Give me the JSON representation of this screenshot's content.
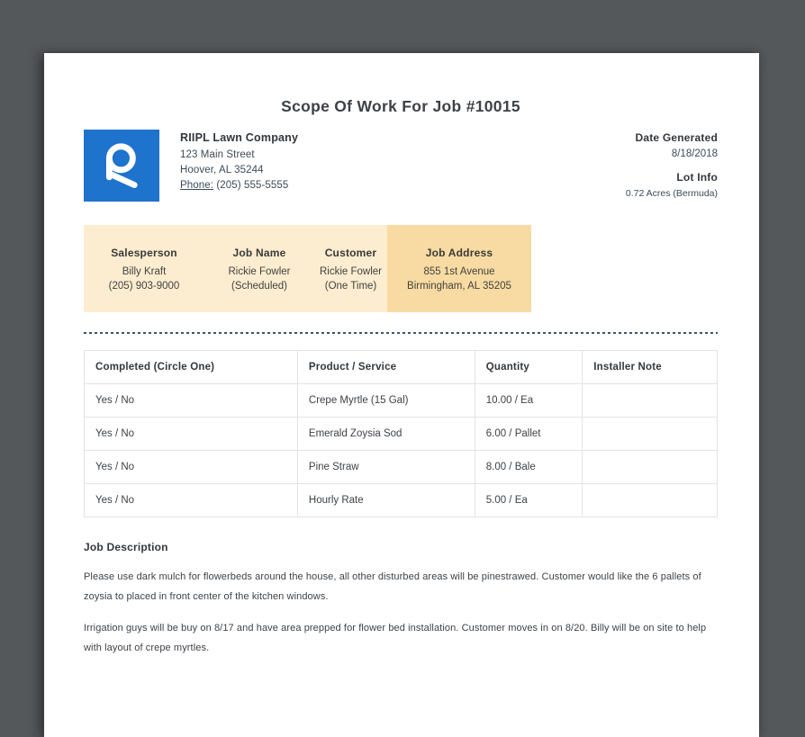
{
  "doc": {
    "title": "Scope Of Work For Job #10015"
  },
  "company": {
    "logo_icon": "r-lettermark",
    "logo_color": "#1e73cc",
    "name": "RIIPL Lawn Company",
    "address_line1": "123 Main Street",
    "address_line2": "Hoover, AL 35244",
    "phone_label": "Phone:",
    "phone_number": "(205) 555-5555"
  },
  "meta": {
    "date_generated_label": "Date Generated",
    "date_generated": "8/18/2018",
    "lot_info_label": "Lot Info",
    "lot_info": "0.72 Acres (Bermuda)"
  },
  "job_info_bar": {
    "bg_color": "#fcecd0",
    "highlight_bg_color": "#f8dba2",
    "cells": [
      {
        "label": "Salesperson",
        "line1": "Billy Kraft",
        "line2": "(205) 903-9000"
      },
      {
        "label": "Job Name",
        "line1": "Rickie Fowler",
        "line2": "(Scheduled)"
      },
      {
        "label": "Customer",
        "line1": "Rickie Fowler",
        "line2": "(One Time)"
      },
      {
        "label": "Job Address",
        "line1": "855 1st Avenue",
        "line2": "Birmingham, AL 35205"
      }
    ]
  },
  "work_table": {
    "headers": [
      "Completed (Circle One)",
      "Product / Service",
      "Quantity",
      "Installer Note"
    ],
    "rows": [
      {
        "completed": "Yes / No",
        "product": "Crepe Myrtle (15 Gal)",
        "quantity": "10.00 / Ea",
        "installer_note": ""
      },
      {
        "completed": "Yes / No",
        "product": "Emerald Zoysia Sod",
        "quantity": "6.00 / Pallet",
        "installer_note": ""
      },
      {
        "completed": "Yes / No",
        "product": "Pine Straw",
        "quantity": "8.00 / Bale",
        "installer_note": ""
      },
      {
        "completed": "Yes / No",
        "product": "Hourly Rate",
        "quantity": "5.00 / Ea",
        "installer_note": ""
      }
    ]
  },
  "job_description": {
    "label": "Job Description",
    "paragraph1": "Please use dark mulch for flowerbeds around the house, all other disturbed areas will be pinestrawed. Customer would like the 6 pallets of zoysia to placed in front center of the kitchen windows.",
    "paragraph2": "Irrigation guys will be buy on 8/17 and have area prepped for flower bed installation. Customer moves in on 8/20. Billy will be on site to help with layout of crepe myrtles."
  }
}
